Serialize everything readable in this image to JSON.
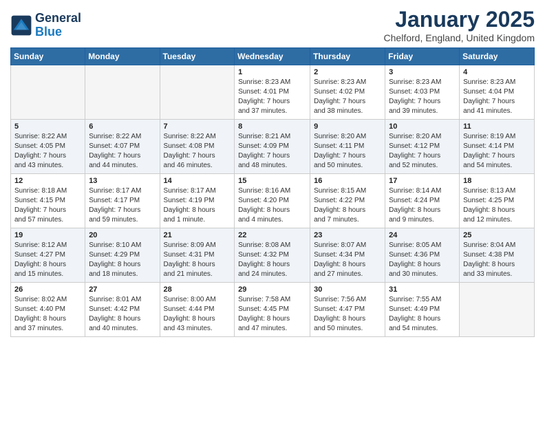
{
  "header": {
    "logo_line1": "General",
    "logo_line2": "Blue",
    "month": "January 2025",
    "location": "Chelford, England, United Kingdom"
  },
  "weekdays": [
    "Sunday",
    "Monday",
    "Tuesday",
    "Wednesday",
    "Thursday",
    "Friday",
    "Saturday"
  ],
  "weeks": [
    [
      {
        "day": "",
        "info": ""
      },
      {
        "day": "",
        "info": ""
      },
      {
        "day": "",
        "info": ""
      },
      {
        "day": "1",
        "info": "Sunrise: 8:23 AM\nSunset: 4:01 PM\nDaylight: 7 hours\nand 37 minutes."
      },
      {
        "day": "2",
        "info": "Sunrise: 8:23 AM\nSunset: 4:02 PM\nDaylight: 7 hours\nand 38 minutes."
      },
      {
        "day": "3",
        "info": "Sunrise: 8:23 AM\nSunset: 4:03 PM\nDaylight: 7 hours\nand 39 minutes."
      },
      {
        "day": "4",
        "info": "Sunrise: 8:23 AM\nSunset: 4:04 PM\nDaylight: 7 hours\nand 41 minutes."
      }
    ],
    [
      {
        "day": "5",
        "info": "Sunrise: 8:22 AM\nSunset: 4:05 PM\nDaylight: 7 hours\nand 43 minutes."
      },
      {
        "day": "6",
        "info": "Sunrise: 8:22 AM\nSunset: 4:07 PM\nDaylight: 7 hours\nand 44 minutes."
      },
      {
        "day": "7",
        "info": "Sunrise: 8:22 AM\nSunset: 4:08 PM\nDaylight: 7 hours\nand 46 minutes."
      },
      {
        "day": "8",
        "info": "Sunrise: 8:21 AM\nSunset: 4:09 PM\nDaylight: 7 hours\nand 48 minutes."
      },
      {
        "day": "9",
        "info": "Sunrise: 8:20 AM\nSunset: 4:11 PM\nDaylight: 7 hours\nand 50 minutes."
      },
      {
        "day": "10",
        "info": "Sunrise: 8:20 AM\nSunset: 4:12 PM\nDaylight: 7 hours\nand 52 minutes."
      },
      {
        "day": "11",
        "info": "Sunrise: 8:19 AM\nSunset: 4:14 PM\nDaylight: 7 hours\nand 54 minutes."
      }
    ],
    [
      {
        "day": "12",
        "info": "Sunrise: 8:18 AM\nSunset: 4:15 PM\nDaylight: 7 hours\nand 57 minutes."
      },
      {
        "day": "13",
        "info": "Sunrise: 8:17 AM\nSunset: 4:17 PM\nDaylight: 7 hours\nand 59 minutes."
      },
      {
        "day": "14",
        "info": "Sunrise: 8:17 AM\nSunset: 4:19 PM\nDaylight: 8 hours\nand 1 minute."
      },
      {
        "day": "15",
        "info": "Sunrise: 8:16 AM\nSunset: 4:20 PM\nDaylight: 8 hours\nand 4 minutes."
      },
      {
        "day": "16",
        "info": "Sunrise: 8:15 AM\nSunset: 4:22 PM\nDaylight: 8 hours\nand 7 minutes."
      },
      {
        "day": "17",
        "info": "Sunrise: 8:14 AM\nSunset: 4:24 PM\nDaylight: 8 hours\nand 9 minutes."
      },
      {
        "day": "18",
        "info": "Sunrise: 8:13 AM\nSunset: 4:25 PM\nDaylight: 8 hours\nand 12 minutes."
      }
    ],
    [
      {
        "day": "19",
        "info": "Sunrise: 8:12 AM\nSunset: 4:27 PM\nDaylight: 8 hours\nand 15 minutes."
      },
      {
        "day": "20",
        "info": "Sunrise: 8:10 AM\nSunset: 4:29 PM\nDaylight: 8 hours\nand 18 minutes."
      },
      {
        "day": "21",
        "info": "Sunrise: 8:09 AM\nSunset: 4:31 PM\nDaylight: 8 hours\nand 21 minutes."
      },
      {
        "day": "22",
        "info": "Sunrise: 8:08 AM\nSunset: 4:32 PM\nDaylight: 8 hours\nand 24 minutes."
      },
      {
        "day": "23",
        "info": "Sunrise: 8:07 AM\nSunset: 4:34 PM\nDaylight: 8 hours\nand 27 minutes."
      },
      {
        "day": "24",
        "info": "Sunrise: 8:05 AM\nSunset: 4:36 PM\nDaylight: 8 hours\nand 30 minutes."
      },
      {
        "day": "25",
        "info": "Sunrise: 8:04 AM\nSunset: 4:38 PM\nDaylight: 8 hours\nand 33 minutes."
      }
    ],
    [
      {
        "day": "26",
        "info": "Sunrise: 8:02 AM\nSunset: 4:40 PM\nDaylight: 8 hours\nand 37 minutes."
      },
      {
        "day": "27",
        "info": "Sunrise: 8:01 AM\nSunset: 4:42 PM\nDaylight: 8 hours\nand 40 minutes."
      },
      {
        "day": "28",
        "info": "Sunrise: 8:00 AM\nSunset: 4:44 PM\nDaylight: 8 hours\nand 43 minutes."
      },
      {
        "day": "29",
        "info": "Sunrise: 7:58 AM\nSunset: 4:45 PM\nDaylight: 8 hours\nand 47 minutes."
      },
      {
        "day": "30",
        "info": "Sunrise: 7:56 AM\nSunset: 4:47 PM\nDaylight: 8 hours\nand 50 minutes."
      },
      {
        "day": "31",
        "info": "Sunrise: 7:55 AM\nSunset: 4:49 PM\nDaylight: 8 hours\nand 54 minutes."
      },
      {
        "day": "",
        "info": ""
      }
    ]
  ]
}
